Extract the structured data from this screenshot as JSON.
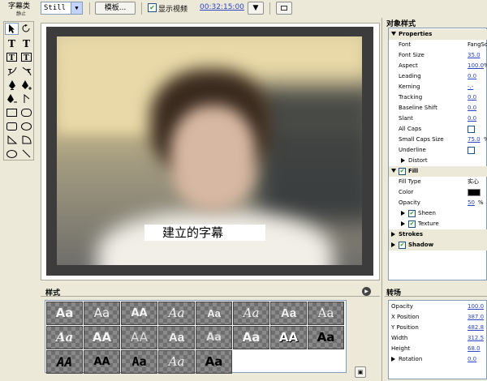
{
  "toolbar": {
    "title_type_label": "字幕类",
    "title_type_sub": "静止",
    "title_type_value": "Still",
    "template_button": "模板...",
    "show_video_label": "显示视频",
    "show_video_checked": true,
    "timecode": "00:32:15:00"
  },
  "preview": {
    "caption_text": "建立的字幕"
  },
  "styles_panel": {
    "title": "样式",
    "swatches": [
      "Aa",
      "Aa",
      "AA",
      "Aa",
      "Aa",
      "Aa",
      "Aa",
      "Aa",
      "Aa",
      "AA",
      "AA",
      "Aa",
      "Aa",
      "Aa",
      "AA",
      "Aa",
      "AA",
      "AA",
      "Aa",
      "Aa",
      "Aa"
    ]
  },
  "object_style": {
    "title": "对象样式",
    "properties_header": "Properties",
    "font_label": "Font",
    "font_value": "FangSo",
    "font_size_label": "Font Size",
    "font_size_value": "35.0",
    "aspect_label": "Aspect",
    "aspect_value": "100.0",
    "aspect_unit": "%",
    "leading_label": "Leading",
    "leading_value": "0.0",
    "kerning_label": "Kerning",
    "kerning_value": "-.-",
    "tracking_label": "Tracking",
    "tracking_value": "0.0",
    "baseline_label": "Baseline Shift",
    "baseline_value": "0.0",
    "slant_label": "Slant",
    "slant_value": "0.0",
    "allcaps_label": "All Caps",
    "smallcaps_size_label": "Small Caps Size",
    "smallcaps_size_value": "75.0",
    "smallcaps_unit": "%",
    "underline_label": "Underline",
    "distort_label": "Distort",
    "fill_header": "Fill",
    "fill_type_label": "Fill Type",
    "fill_type_value": "实心",
    "color_label": "Color",
    "opacity_label": "Opacity",
    "opacity_value": "50",
    "opacity_unit": "%",
    "sheen_label": "Sheen",
    "texture_label": "Texture",
    "strokes_header": "Strokes",
    "shadow_header": "Shadow",
    "fill_color": "#000000"
  },
  "transform": {
    "title": "转场",
    "opacity_label": "Opacity",
    "opacity_value": "100.0",
    "xpos_label": "X Position",
    "xpos_value": "387.0",
    "ypos_label": "Y Position",
    "ypos_value": "482.8",
    "width_label": "Width",
    "width_value": "312.5",
    "height_label": "Height",
    "height_value": "68.0",
    "rotation_label": "Rotation",
    "rotation_value": "0.0"
  }
}
